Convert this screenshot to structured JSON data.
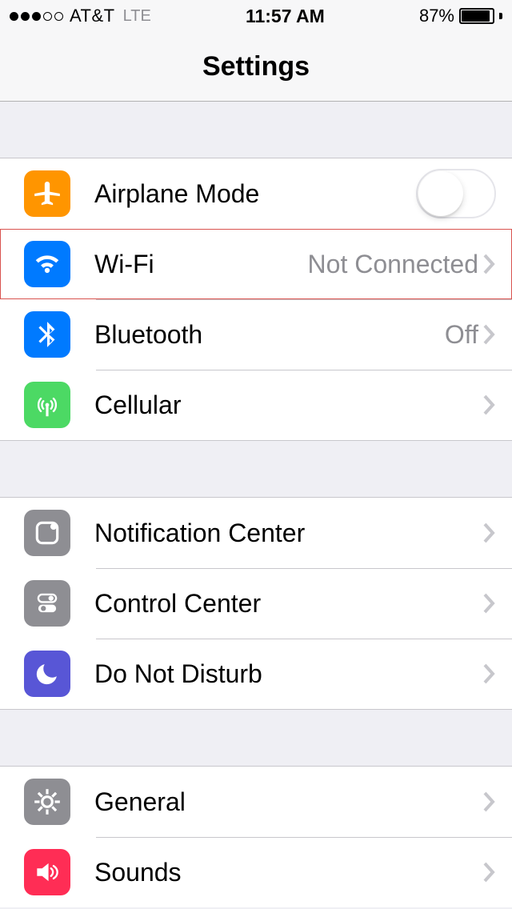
{
  "status": {
    "carrier": "AT&T",
    "network": "LTE",
    "time": "11:57 AM",
    "battery_percent": "87%"
  },
  "header": {
    "title": "Settings"
  },
  "groups": [
    {
      "rows": [
        {
          "key": "airplane",
          "label": "Airplane Mode",
          "value": "",
          "control": "toggle",
          "toggle_on": false
        },
        {
          "key": "wifi",
          "label": "Wi-Fi",
          "value": "Not Connected",
          "control": "chevron",
          "highlighted": true
        },
        {
          "key": "bluetooth",
          "label": "Bluetooth",
          "value": "Off",
          "control": "chevron"
        },
        {
          "key": "cellular",
          "label": "Cellular",
          "value": "",
          "control": "chevron"
        }
      ]
    },
    {
      "rows": [
        {
          "key": "notifications",
          "label": "Notification Center",
          "value": "",
          "control": "chevron"
        },
        {
          "key": "controlcenter",
          "label": "Control Center",
          "value": "",
          "control": "chevron"
        },
        {
          "key": "dnd",
          "label": "Do Not Disturb",
          "value": "",
          "control": "chevron"
        }
      ]
    },
    {
      "rows": [
        {
          "key": "general",
          "label": "General",
          "value": "",
          "control": "chevron"
        },
        {
          "key": "sounds",
          "label": "Sounds",
          "value": "",
          "control": "chevron"
        }
      ]
    }
  ],
  "icons": {
    "airplane": {
      "name": "airplane-icon",
      "bg": "bg-orange"
    },
    "wifi": {
      "name": "wifi-icon",
      "bg": "bg-blue"
    },
    "bluetooth": {
      "name": "bluetooth-icon",
      "bg": "bg-blue"
    },
    "cellular": {
      "name": "cellular-icon",
      "bg": "bg-green"
    },
    "notifications": {
      "name": "notification-center-icon",
      "bg": "bg-gray"
    },
    "controlcenter": {
      "name": "control-center-icon",
      "bg": "bg-gray"
    },
    "dnd": {
      "name": "moon-icon",
      "bg": "bg-purple"
    },
    "general": {
      "name": "gear-icon",
      "bg": "bg-gray"
    },
    "sounds": {
      "name": "speaker-icon",
      "bg": "bg-red"
    }
  }
}
